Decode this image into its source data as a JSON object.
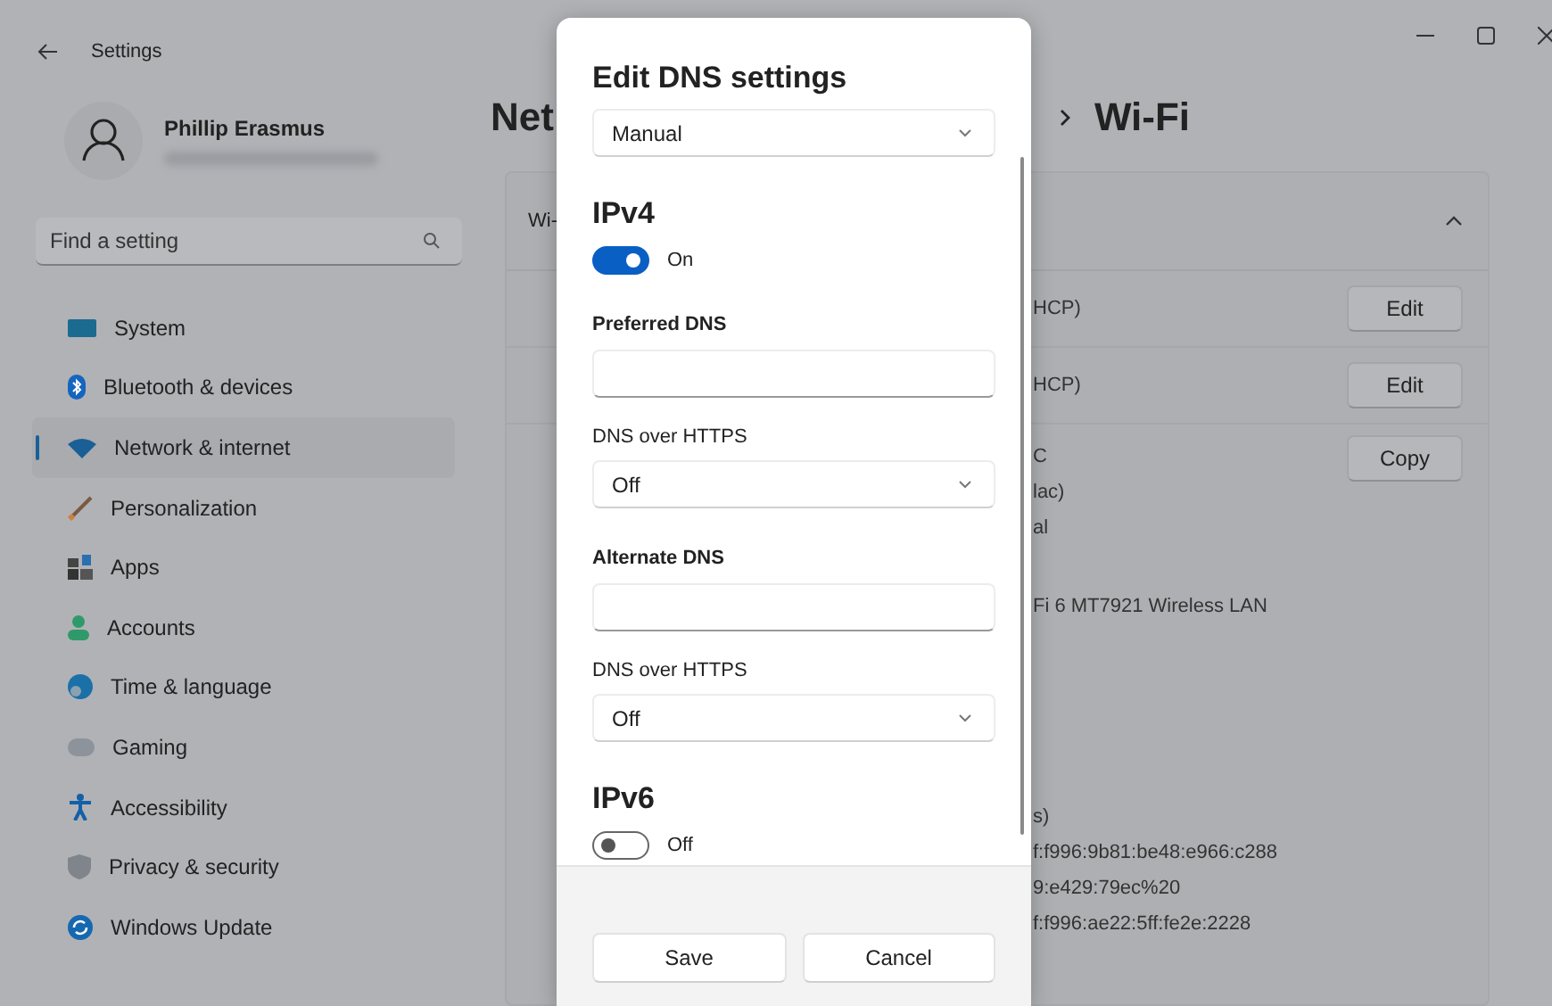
{
  "window": {
    "title": "Settings"
  },
  "profile": {
    "name": "Phillip Erasmus"
  },
  "search": {
    "placeholder": "Find a setting"
  },
  "sidebar": {
    "items": [
      {
        "label": "System",
        "selected": false
      },
      {
        "label": "Bluetooth & devices",
        "selected": false
      },
      {
        "label": "Network & internet",
        "selected": true
      },
      {
        "label": "Personalization",
        "selected": false
      },
      {
        "label": "Apps",
        "selected": false
      },
      {
        "label": "Accounts",
        "selected": false
      },
      {
        "label": "Time & language",
        "selected": false
      },
      {
        "label": "Gaming",
        "selected": false
      },
      {
        "label": "Accessibility",
        "selected": false
      },
      {
        "label": "Privacy & security",
        "selected": false
      },
      {
        "label": "Windows Update",
        "selected": false
      }
    ]
  },
  "content": {
    "breadcrumb_start": "Net",
    "breadcrumb_end": "Wi-Fi",
    "card_header": "Wi-",
    "expanded": true,
    "rows": [
      {
        "lines": [
          "HCP)"
        ],
        "button": "Edit"
      },
      {
        "lines": [
          "HCP)"
        ],
        "button": "Edit"
      },
      {
        "lines": [
          "C",
          "lac)",
          "al"
        ],
        "button": "Copy"
      },
      {
        "lines": [
          "Fi 6 MT7921 Wireless LAN"
        ]
      },
      {
        "lines": [
          "s)",
          "f:f996:9b81:be48:e966:c288",
          "9:e429:79ec%20",
          "f:f996:ae22:5ff:fe2e:2228"
        ]
      }
    ]
  },
  "dialog": {
    "title": "Edit DNS settings",
    "mode": "Manual",
    "sections": [
      {
        "heading": "IPv4",
        "toggle": {
          "on": true,
          "label": "On"
        },
        "fields": [
          {
            "label": "Preferred DNS",
            "doh_label": "DNS over HTTPS",
            "dns_over_https": "Off"
          },
          {
            "label": "Alternate DNS",
            "doh_label": "DNS over HTTPS",
            "dns_over_https": "Off"
          }
        ]
      },
      {
        "heading": "IPv6",
        "toggle": {
          "on": false,
          "label": "Off"
        }
      }
    ],
    "buttons": [
      "Save",
      "Cancel"
    ]
  }
}
